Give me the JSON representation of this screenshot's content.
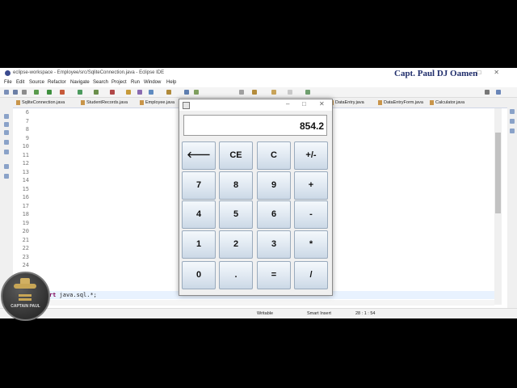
{
  "ide": {
    "window_title": "eclipse-workspace - Employee/src/SqliteConnection.java - Eclipse IDE",
    "watermark": "Capt. Paul DJ Oamen",
    "menu": [
      "File",
      "Edit",
      "Source",
      "Refactor",
      "Navigate",
      "Search",
      "Project",
      "Run",
      "Window",
      "Help"
    ],
    "tabs": [
      "SqliteConnection.java",
      "StudentRecords.java",
      "Employee.java",
      "DataEntry.java",
      "DataEntryForm.java",
      "Calculator.java"
    ],
    "line_numbers": [
      "6",
      "7",
      "8",
      "9",
      "10",
      "11",
      "12",
      "13",
      "14",
      "15",
      "16",
      "17",
      "18",
      "19",
      "20",
      "21",
      "22",
      "23",
      "24"
    ],
    "code": {
      "keyword": "import",
      "rest": " java.sql.*;"
    },
    "status": {
      "mode": "Writable",
      "insert": "Smart Insert",
      "position": "28 : 1 : 54"
    }
  },
  "logo": {
    "text": "CAPTAIN PAUL"
  },
  "calculator": {
    "display": "854.2",
    "buttons": [
      [
        "🡐",
        "CE",
        "C",
        "+/-"
      ],
      [
        "7",
        "8",
        "9",
        "+"
      ],
      [
        "4",
        "5",
        "6",
        "-"
      ],
      [
        "1",
        "2",
        "3",
        "*"
      ],
      [
        "0",
        ".",
        "=",
        "/"
      ]
    ]
  }
}
